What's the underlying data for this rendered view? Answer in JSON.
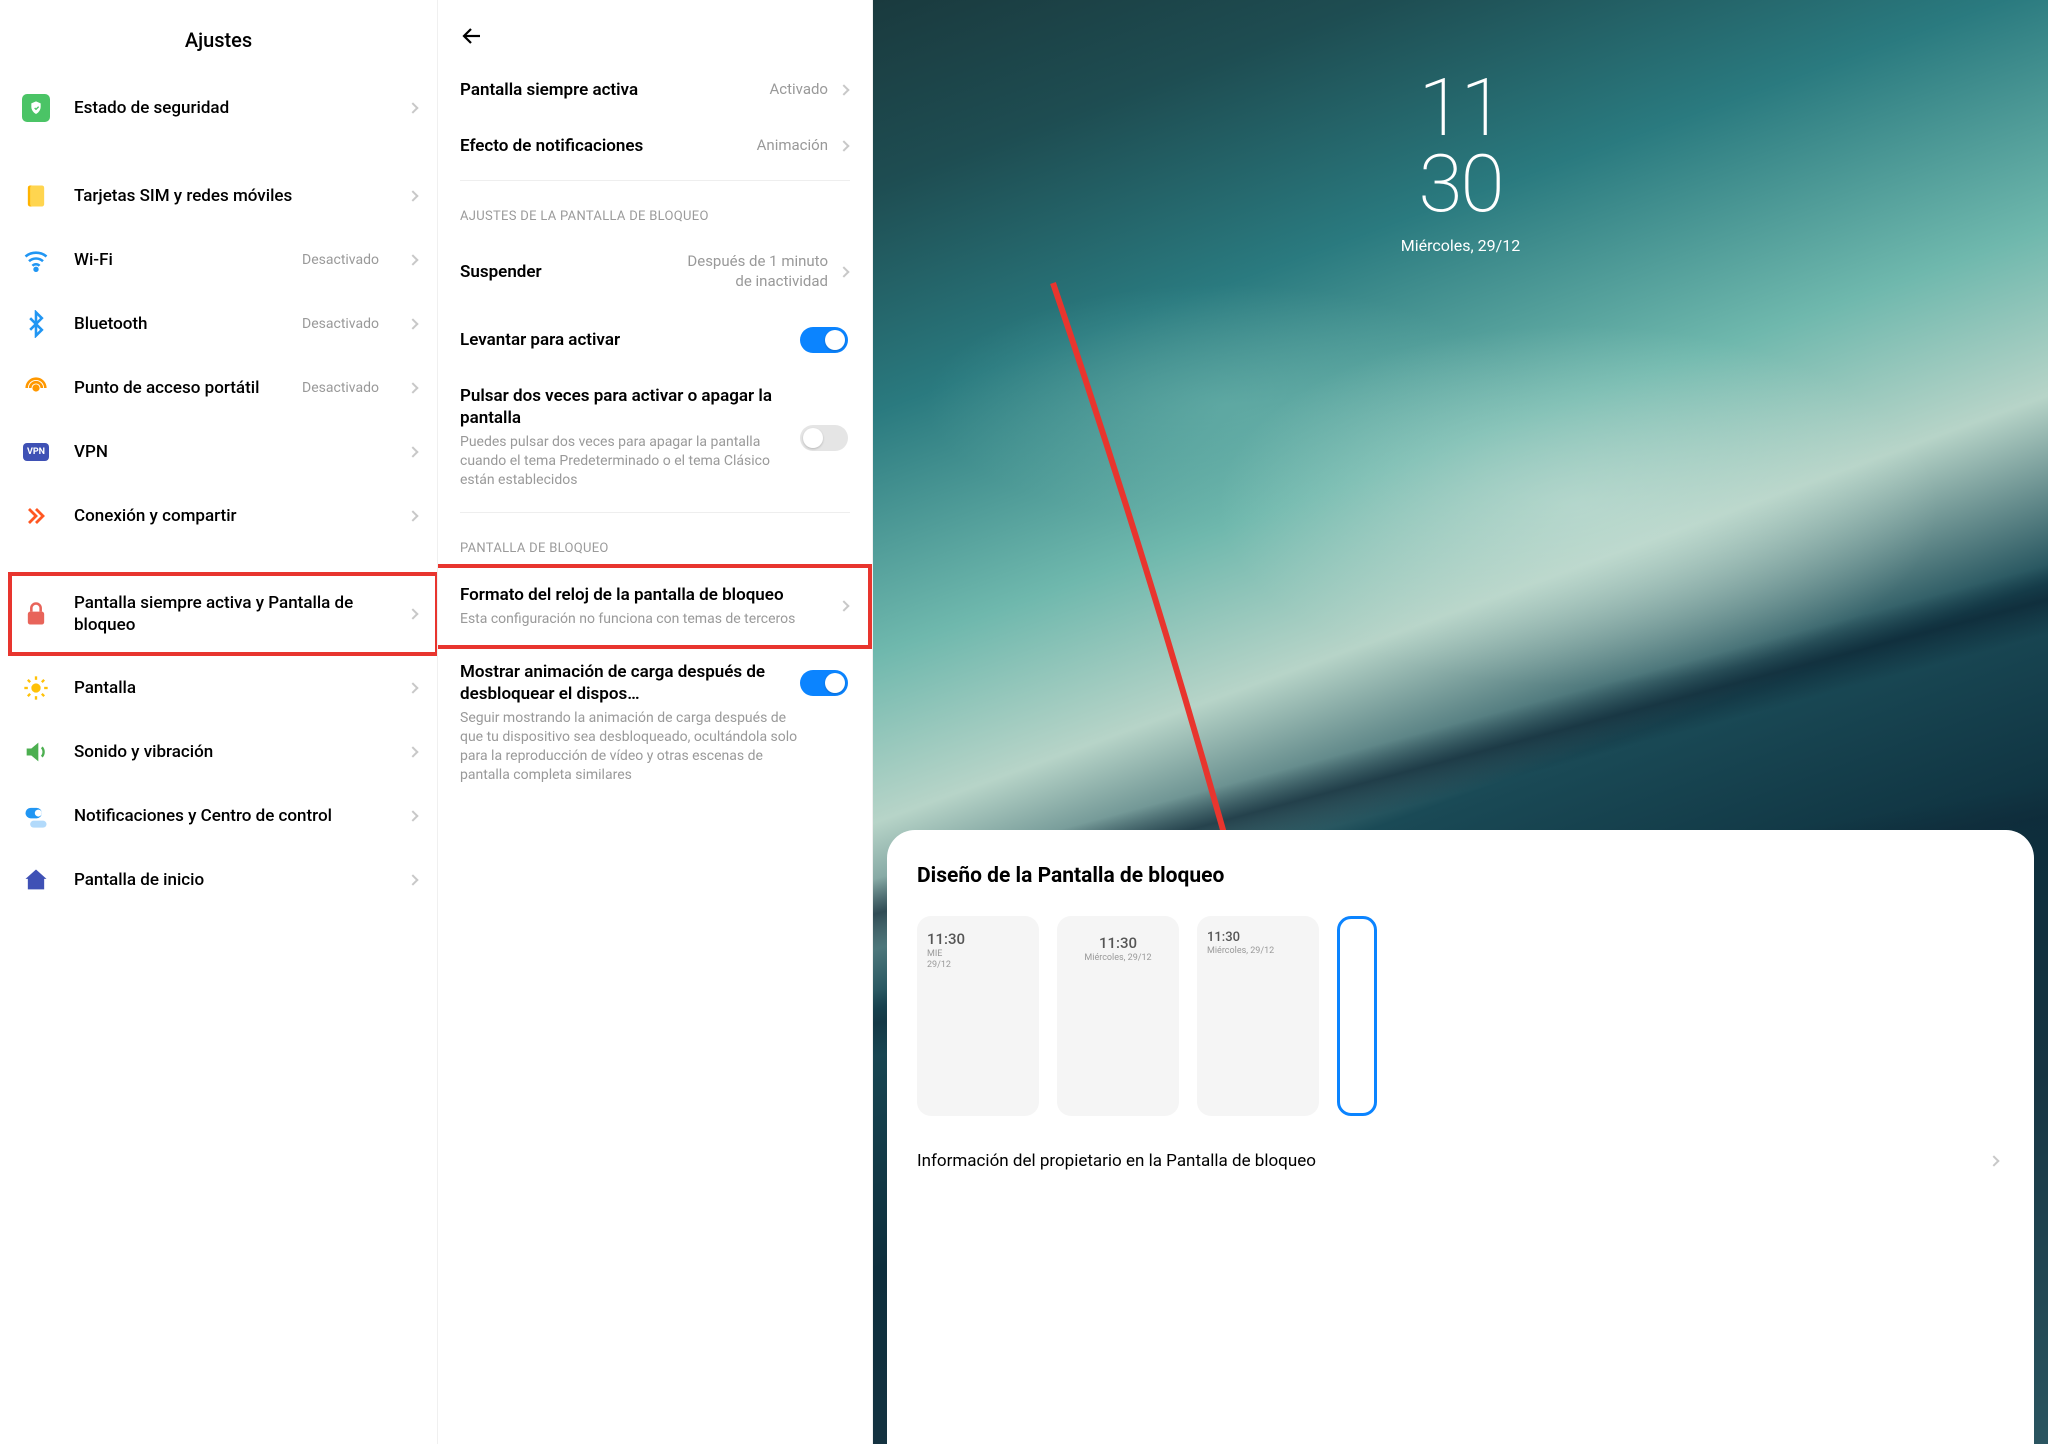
{
  "col1": {
    "title": "Ajustes",
    "items": [
      {
        "icon": "shield",
        "label": "Estado de seguridad"
      },
      {
        "icon": "sim",
        "label": "Tarjetas SIM y redes móviles"
      },
      {
        "icon": "wifi",
        "label": "Wi-Fi",
        "status": "Desactivado"
      },
      {
        "icon": "bt",
        "label": "Bluetooth",
        "status": "Desactivado"
      },
      {
        "icon": "hot",
        "label": "Punto de acceso portátil",
        "status": "Desactivado"
      },
      {
        "icon": "vpn",
        "label": "VPN"
      },
      {
        "icon": "share",
        "label": "Conexión y compartir"
      },
      {
        "icon": "lock",
        "label": "Pantalla siempre activa y Pantalla de bloqueo",
        "hl": true
      },
      {
        "icon": "sun",
        "label": "Pantalla"
      },
      {
        "icon": "sound",
        "label": "Sonido y vibración"
      },
      {
        "icon": "notif",
        "label": "Notificaciones y Centro de control"
      },
      {
        "icon": "home",
        "label": "Pantalla de inicio"
      }
    ]
  },
  "col2": {
    "rows1": [
      {
        "label": "Pantalla siempre activa",
        "val": "Activado"
      },
      {
        "label": "Efecto de notificaciones",
        "val": "Animación"
      }
    ],
    "section1": "AJUSTES DE LA PANTALLA DE BLOQUEO",
    "suspend": {
      "label": "Suspender",
      "val": "Después de 1 minuto de inactividad"
    },
    "raise": {
      "label": "Levantar para activar",
      "on": true
    },
    "doubletap": {
      "title": "Pulsar dos veces para activar o apagar la pantalla",
      "sub": "Puedes pulsar dos veces para apagar la pantalla cuando el tema Predeterminado o el tema Clásico están establecidos",
      "on": false
    },
    "section2": "PANTALLA DE BLOQUEO",
    "clockfmt": {
      "title": "Formato del reloj de la pantalla de bloqueo",
      "sub": "Esta configuración no funciona con temas de terceros",
      "hl": true
    },
    "chargeanim": {
      "title": "Mostrar animación de carga después de desbloquear el dispos…",
      "sub": "Seguir mostrando la animación de carga después de que tu dispositivo sea desbloqueado, ocultándola solo para la reproducción de vídeo y otras escenas de pantalla completa similares",
      "on": true
    }
  },
  "col3": {
    "clock": {
      "h": "11",
      "m": "30",
      "date": "Miércoles, 29/12"
    },
    "sheet": {
      "title": "Diseño de la Pantalla de bloqueo",
      "cards": [
        {
          "t": "11:30",
          "d1": "MIE",
          "d2": "29/12",
          "align": "left"
        },
        {
          "t": "11:30",
          "d1": "Miércoles, 29/12",
          "align": "center"
        },
        {
          "t": "11:30",
          "d1": "Miércoles, 29/12",
          "align": "left"
        }
      ],
      "owner": "Información del propietario en la Pantalla de bloqueo"
    }
  }
}
